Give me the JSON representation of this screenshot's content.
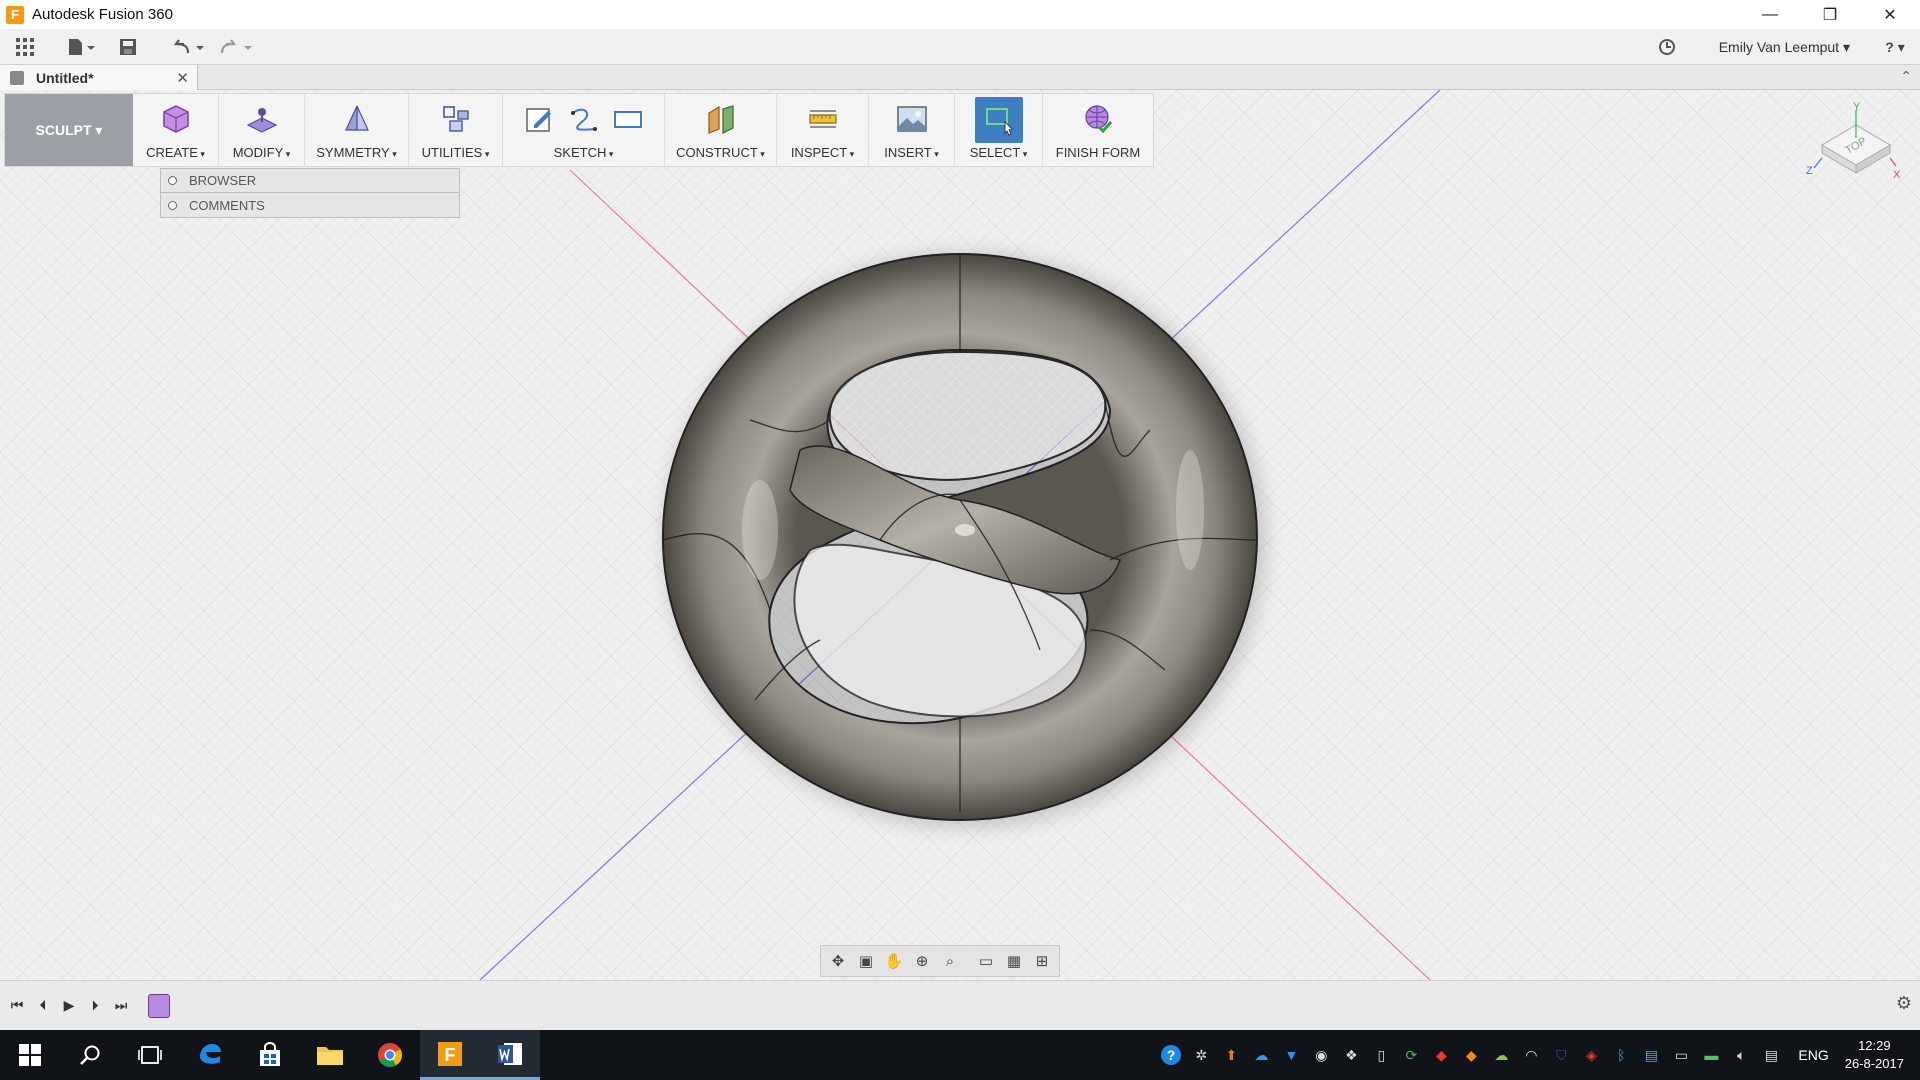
{
  "window": {
    "title": "Autodesk Fusion 360",
    "logo_letter": "F",
    "controls": {
      "minimize": "—",
      "restore": "❐",
      "close": "✕"
    }
  },
  "qat": {
    "user_name": "Emily Van Leemput ▾",
    "help_label": "? ▾"
  },
  "document": {
    "tab_name": "Untitled*",
    "close": "✕",
    "collapse": "⌃"
  },
  "toolbar": {
    "workspace": "SCULPT ▾",
    "groups": [
      {
        "key": "create",
        "label": "CREATE",
        "icon": "cube-icon",
        "color": "#b070d0"
      },
      {
        "key": "modify",
        "label": "MODIFY",
        "icon": "modify-plane-icon",
        "color": "#8a78c8"
      },
      {
        "key": "symmetry",
        "label": "SYMMETRY",
        "icon": "symmetry-icon",
        "color": "#7068c0"
      },
      {
        "key": "utilities",
        "label": "UTILITIES",
        "icon": "utilities-icon",
        "color": "#6a74b6"
      },
      {
        "key": "sketch",
        "label": "SKETCH",
        "icon": "sketch-icon",
        "color": "#3f79c8"
      },
      {
        "key": "construct",
        "label": "CONSTRUCT",
        "icon": "construct-plane-icon",
        "color": "#d48a2a"
      },
      {
        "key": "inspect",
        "label": "INSPECT",
        "icon": "measure-icon",
        "color": "#e0a020"
      },
      {
        "key": "insert",
        "label": "INSERT",
        "icon": "image-icon",
        "color": "#6a8aa8"
      },
      {
        "key": "select",
        "label": "SELECT",
        "icon": "select-box-icon",
        "color": "#2f6fb8"
      },
      {
        "key": "finish_form",
        "label": "FINISH FORM",
        "icon": "finish-form-icon",
        "color": "#8a4fc6"
      }
    ]
  },
  "browser_panels": [
    {
      "label": "BROWSER"
    },
    {
      "label": "COMMENTS"
    }
  ],
  "viewcube": {
    "face_label": "TOP",
    "axis_x": "X",
    "axis_y": "Y",
    "axis_z": "Z"
  },
  "navbar": {
    "icons": [
      "orbit-icon",
      "look-at-icon",
      "pan-icon",
      "zoom-window-icon",
      "zoom-icon",
      "display-settings-icon",
      "grid-settings-icon",
      "viewports-icon"
    ]
  },
  "timeline": {
    "buttons": {
      "first": "⏮",
      "prev": "⏴",
      "play": "▶",
      "next": "⏵",
      "last": "⏭"
    },
    "settings_icon": "gear-icon"
  },
  "taskbar": {
    "apps": [
      "windows-start-icon",
      "search-icon",
      "task-view-icon",
      "edge-icon",
      "store-icon",
      "file-explorer-icon",
      "chrome-icon",
      "fusion360-icon",
      "word-icon"
    ],
    "language": "ENG",
    "time": "12:29",
    "date": "26-8-2017"
  }
}
